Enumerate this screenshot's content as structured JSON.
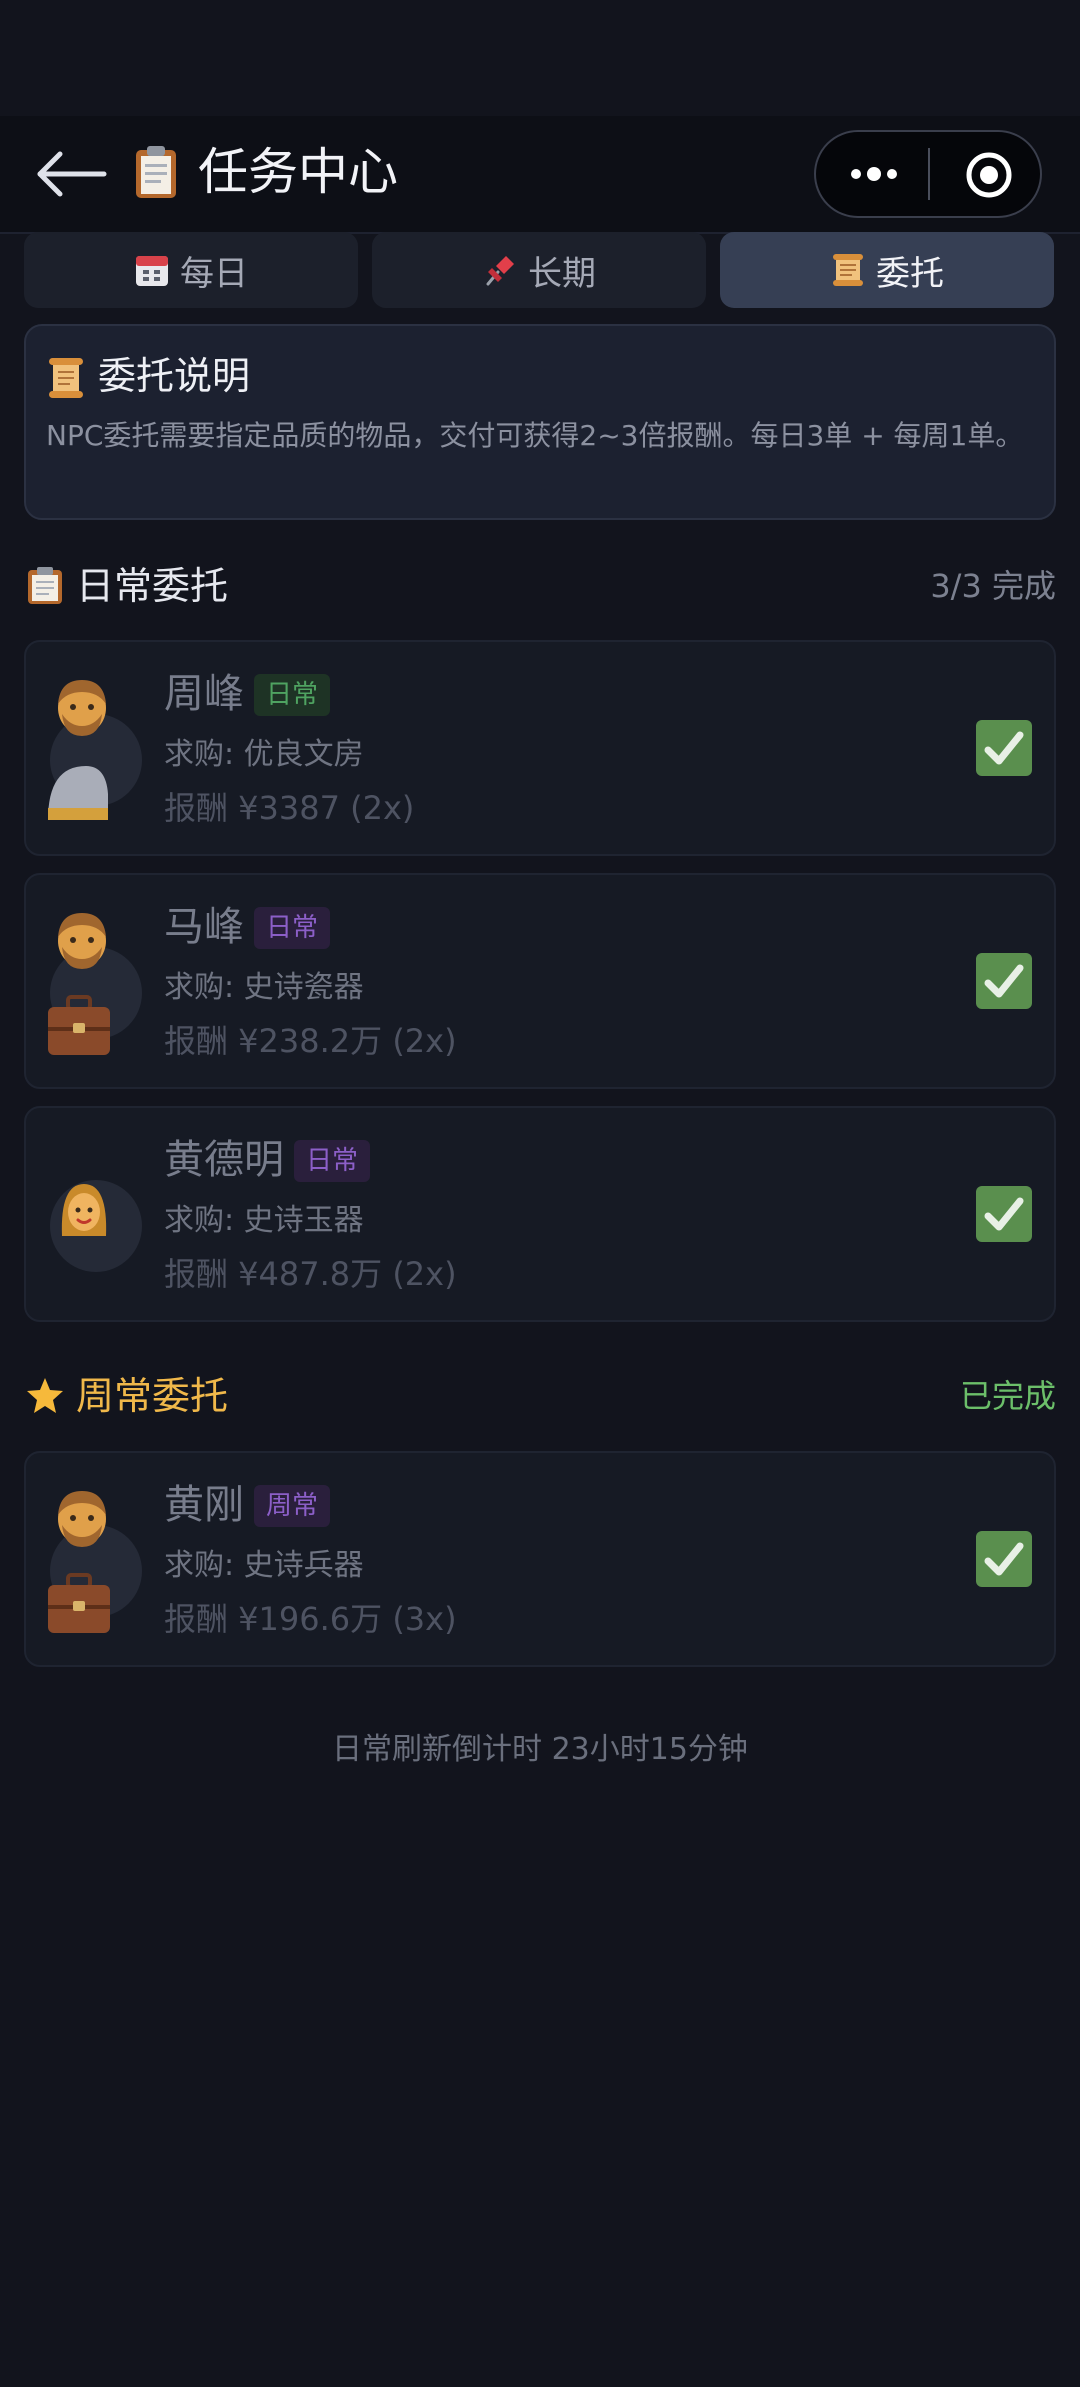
{
  "nav": {
    "title": "任务中心"
  },
  "tabs": [
    {
      "label": "每日",
      "icon": "calendar-icon"
    },
    {
      "label": "长期",
      "icon": "pushpin-icon"
    },
    {
      "label": "委托",
      "icon": "scroll-icon",
      "active": true
    }
  ],
  "info": {
    "title": "委托说明",
    "text": "NPC委托需要指定品质的物品，交付可获得2~3倍报酬。每日3单 + 每周1单。"
  },
  "daily": {
    "title": "日常委托",
    "status": "3/3 完成",
    "items": [
      {
        "name": "周峰",
        "tag": "日常",
        "item": "求购: 优良文房",
        "reward": "报酬 ¥3387 (2x)",
        "completed": true
      },
      {
        "name": "马峰",
        "tag": "日常",
        "item": "求购: 史诗瓷器",
        "reward": "报酬 ¥238.2万 (2x)",
        "completed": true
      },
      {
        "name": "黄德明",
        "tag": "日常",
        "item": "求购: 史诗玉器",
        "reward": "报酬 ¥487.8万 (2x)",
        "completed": true
      }
    ]
  },
  "weekly": {
    "title": "周常委托",
    "status": "已完成",
    "items": [
      {
        "name": "黄刚",
        "tag": "周常",
        "item": "求购: 史诗兵器",
        "reward": "报酬 ¥196.6万 (3x)",
        "completed": true
      }
    ]
  },
  "footer": {
    "text": "日常刷新倒计时 23小时15分钟"
  },
  "colors": {
    "background": "#12141d",
    "active_tab": "#363f54",
    "weekly_accent": "#f0b84a",
    "done_green": "#6cbf6a",
    "check_green": "#5a8f4e"
  }
}
